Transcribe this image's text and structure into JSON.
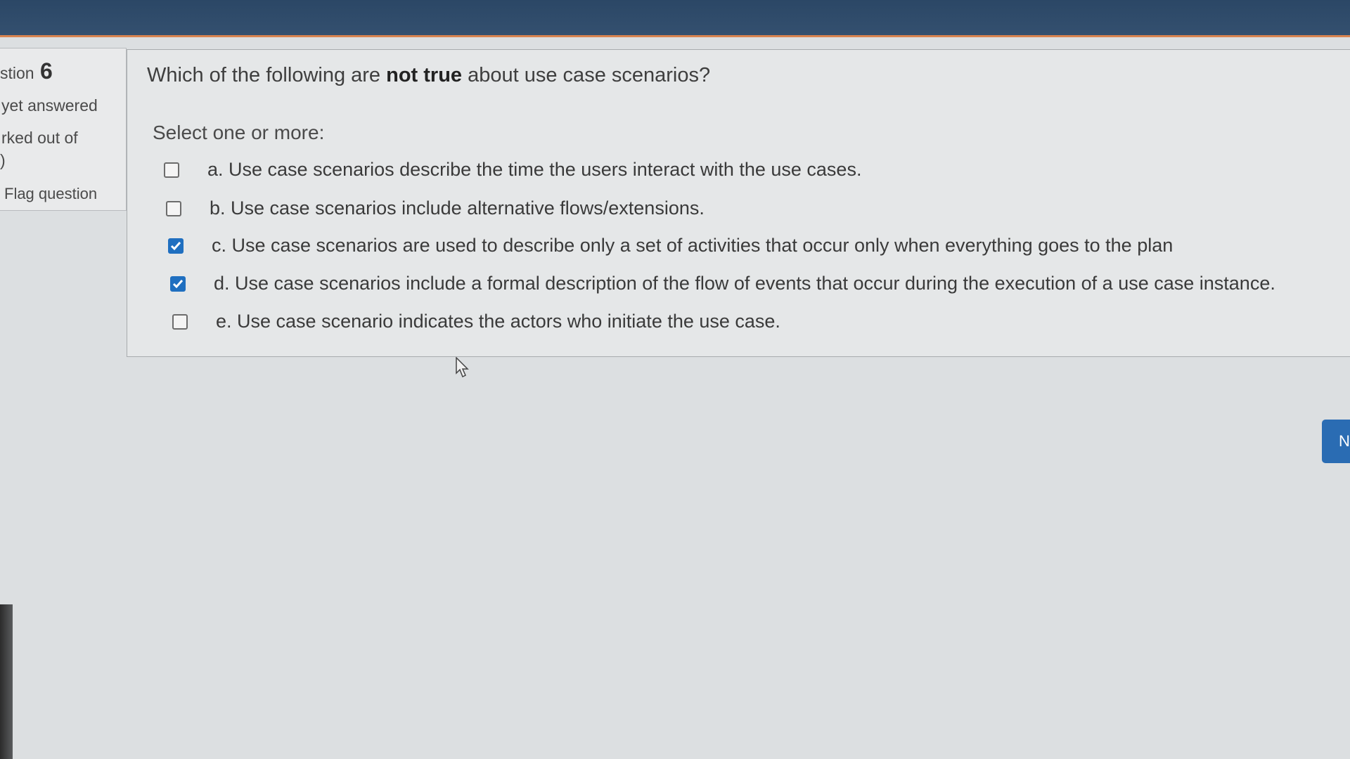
{
  "sidebar": {
    "question_label": "stion",
    "question_number": "6",
    "status": "yet answered",
    "marked_label": "rked out of",
    "marked_value": ")",
    "flag_label": "Flag question"
  },
  "question": {
    "text_before": "Which of the following are ",
    "text_bold": "not true",
    "text_after": " about use case scenarios?",
    "prompt": "Select one or more:",
    "options": [
      {
        "label": "a. Use case scenarios describe the time the users interact with the use cases.",
        "checked": false
      },
      {
        "label": "b. Use case scenarios include alternative flows/extensions.",
        "checked": false
      },
      {
        "label": "c. Use case scenarios are used to describe only a set of activities that occur only when everything goes to the plan",
        "checked": true
      },
      {
        "label": "d. Use case scenarios include a  formal description of the flow of events that occur during the execution of a use case instance.",
        "checked": true
      },
      {
        "label": "e. Use case scenario indicates the actors who initiate the use case.",
        "checked": false
      }
    ]
  },
  "navigation": {
    "next_label": "N"
  },
  "colors": {
    "topbar": "#2b4766",
    "accent_line": "#d9844f",
    "checkbox_checked": "#1f6fc0",
    "next_button": "#2a6cb3"
  }
}
